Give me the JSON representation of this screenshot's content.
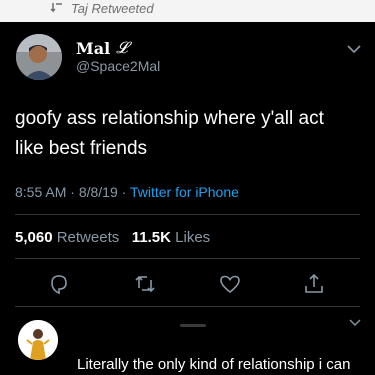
{
  "retweet_banner": {
    "text": "Taj Retweeted"
  },
  "tweet": {
    "display_name": "Mal",
    "display_name_emoji": "𝓛",
    "handle": "@Space2Mal",
    "text_line1": "goofy ass relationship where y'all act",
    "text_line2": "like best friends",
    "time": "8:55 AM",
    "date": "8/8/19",
    "separator": "·",
    "client": "Twitter for iPhone",
    "retweets_count": "5,060",
    "retweets_label": "Retweets",
    "likes_count": "11.5K",
    "likes_label": "Likes"
  },
  "actions": [
    "reply-icon",
    "retweet-icon",
    "like-icon",
    "share-icon"
  ],
  "reply": {
    "text": "Literally the only kind of relationship i can"
  },
  "colors": {
    "background": "#000000",
    "secondary_text": "#8899a6",
    "link": "#1da1f2",
    "divider": "#2f3336"
  }
}
